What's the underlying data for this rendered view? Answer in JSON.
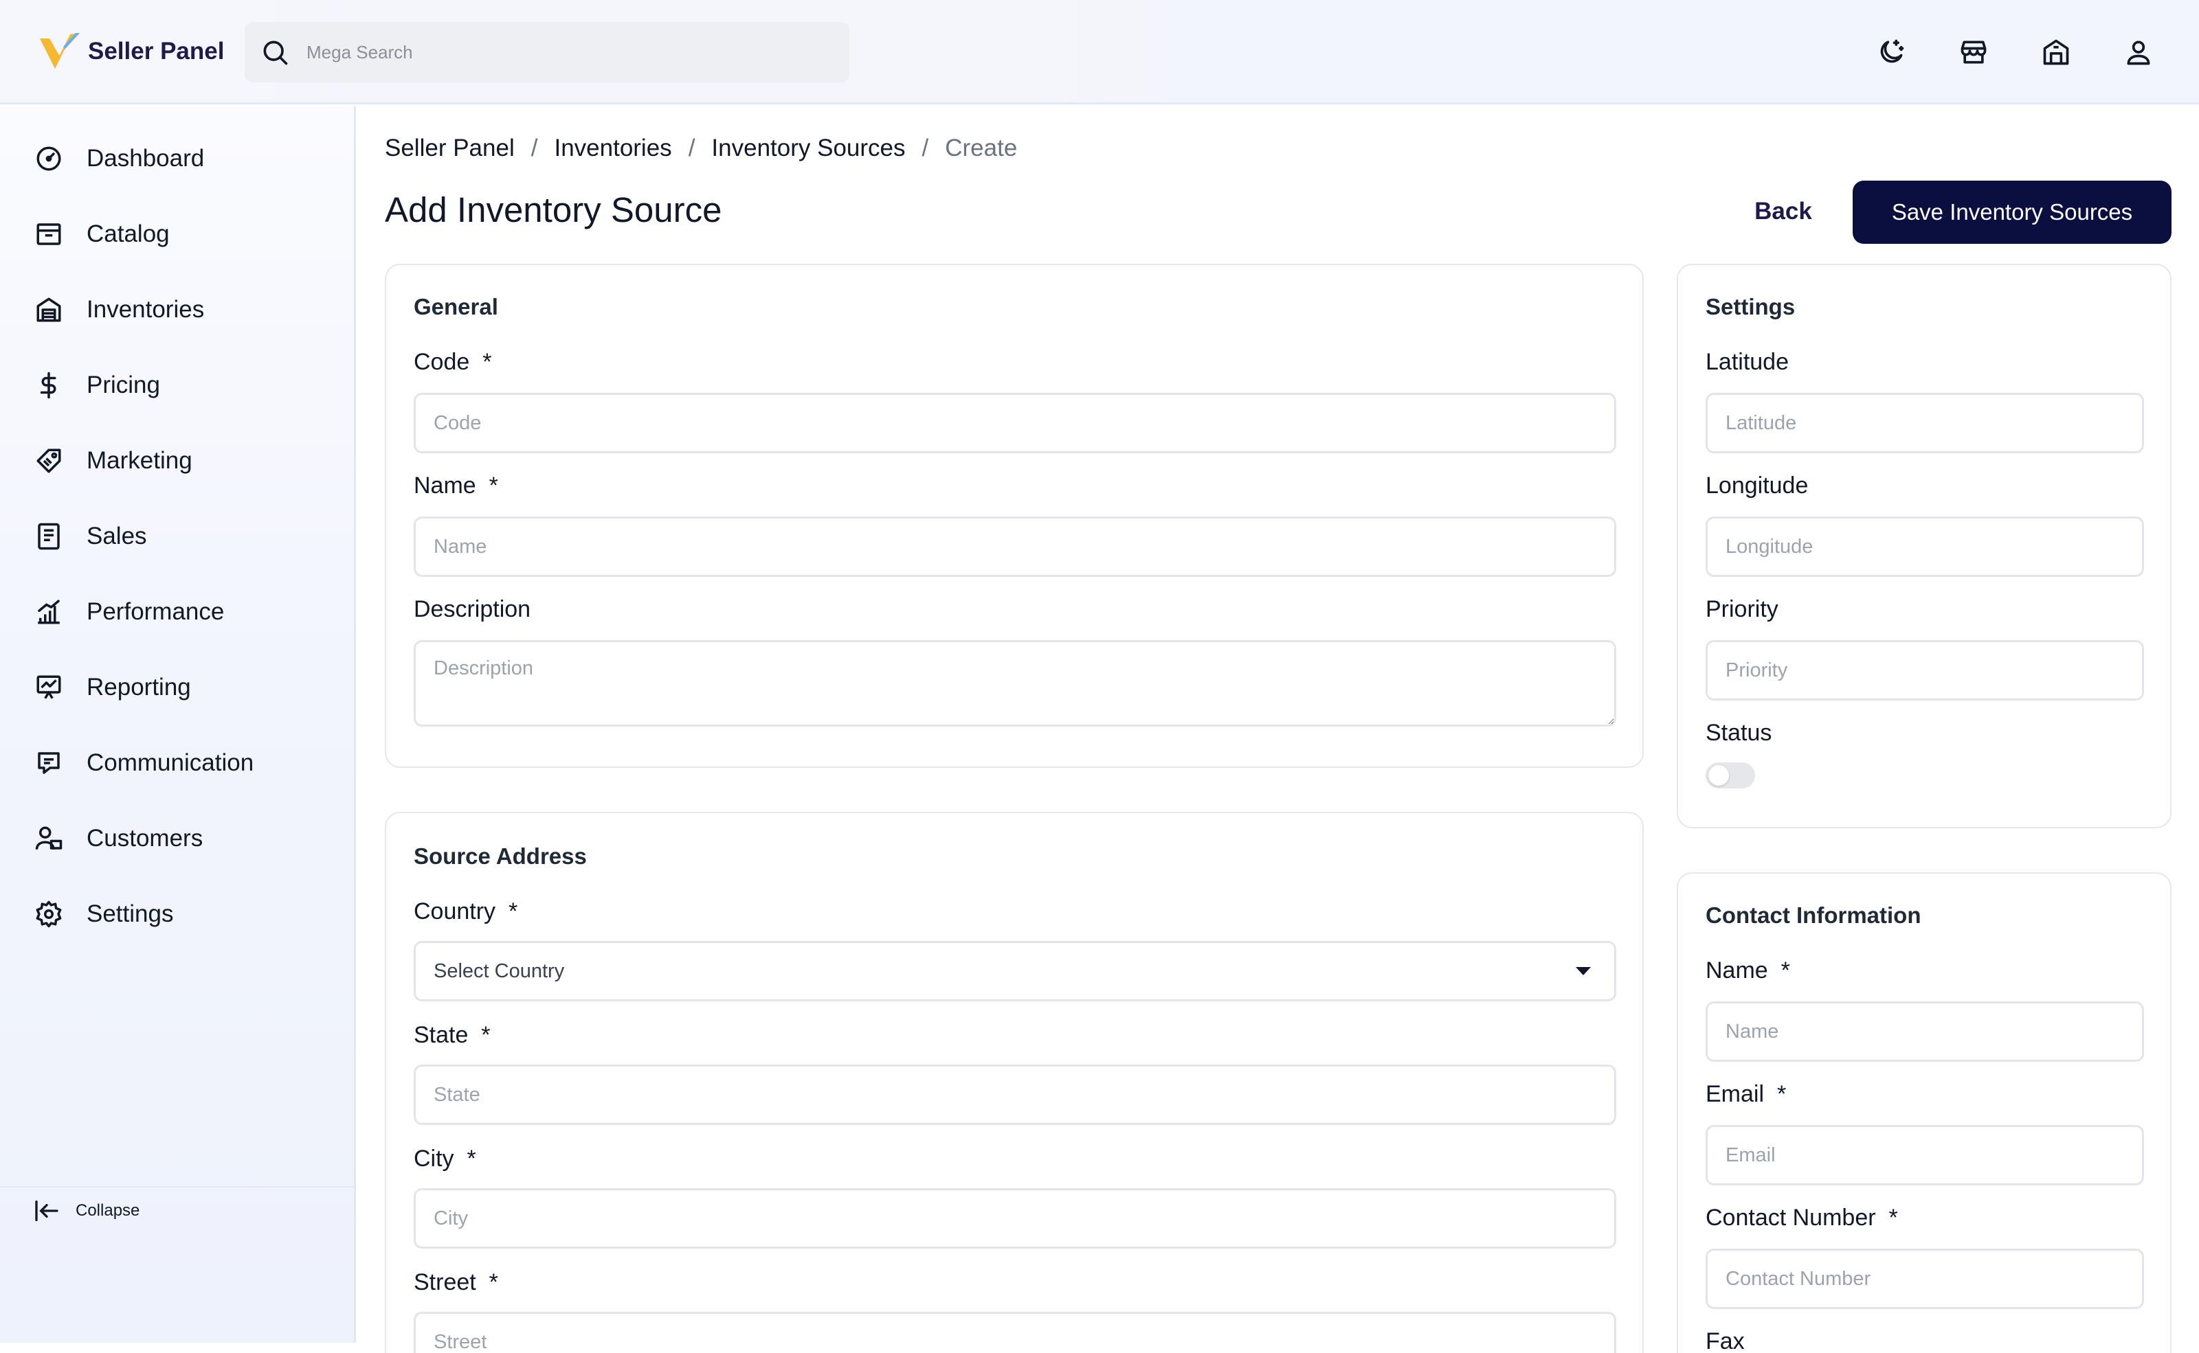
{
  "header": {
    "brand": "Seller Panel",
    "search_placeholder": "Mega Search",
    "icons": [
      "moon-icon",
      "storefront-icon",
      "warehouse-icon",
      "user-icon"
    ]
  },
  "sidebar": {
    "items": [
      {
        "label": "Dashboard",
        "icon": "dashboard-icon"
      },
      {
        "label": "Catalog",
        "icon": "catalog-icon"
      },
      {
        "label": "Inventories",
        "icon": "inventories-icon"
      },
      {
        "label": "Pricing",
        "icon": "dollar-icon"
      },
      {
        "label": "Marketing",
        "icon": "tag-icon"
      },
      {
        "label": "Sales",
        "icon": "sales-icon"
      },
      {
        "label": "Performance",
        "icon": "performance-icon"
      },
      {
        "label": "Reporting",
        "icon": "reporting-icon"
      },
      {
        "label": "Communication",
        "icon": "communication-icon"
      },
      {
        "label": "Customers",
        "icon": "customers-icon"
      },
      {
        "label": "Settings",
        "icon": "gear-icon"
      }
    ],
    "collapse_label": "Collapse"
  },
  "breadcrumb": [
    "Seller Panel",
    "Inventory Sources",
    "Inventories",
    "Create"
  ],
  "breadcrumb_ordered": [
    "Seller Panel",
    "Inventories",
    "Inventory Sources",
    "Create"
  ],
  "page": {
    "title": "Add Inventory Source",
    "back_label": "Back",
    "save_label": "Save Inventory Sources"
  },
  "general": {
    "title": "General",
    "code_label": "Code",
    "code_placeholder": "Code",
    "name_label": "Name",
    "name_placeholder": "Name",
    "description_label": "Description",
    "description_placeholder": "Description"
  },
  "source_address": {
    "title": "Source Address",
    "country_label": "Country",
    "country_value": "Select Country",
    "state_label": "State",
    "state_placeholder": "State",
    "city_label": "City",
    "city_placeholder": "City",
    "street_label": "Street",
    "street_placeholder": "Street"
  },
  "settings": {
    "title": "Settings",
    "latitude_label": "Latitude",
    "latitude_placeholder": "Latitude",
    "longitude_label": "Longitude",
    "longitude_placeholder": "Longitude",
    "priority_label": "Priority",
    "priority_placeholder": "Priority",
    "status_label": "Status",
    "status_on": false
  },
  "contact": {
    "title": "Contact Information",
    "name_label": "Name",
    "name_placeholder": "Name",
    "email_label": "Email",
    "email_placeholder": "Email",
    "number_label": "Contact Number",
    "number_placeholder": "Contact Number",
    "fax_label": "Fax"
  },
  "required_marker": "*",
  "colors": {
    "primary": "#0b0f3f",
    "brand_text": "#1e1b4b",
    "logo_yellow": "#f5b82e"
  }
}
